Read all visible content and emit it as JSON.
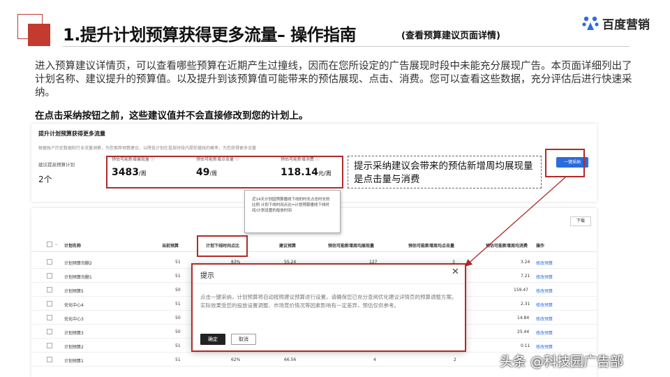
{
  "slide": {
    "title": "1.提升计划预算获得更多流量– 操作指南",
    "subtitle": "(查看预算建议页面详情)",
    "logo_text": "百度营销",
    "intro": "进入预算建议详情页，可以查看哪些预算在近期产生过撞线，因而在您所设定的广告展现时段中未能充分展现广告。本页面详细列出了计划名称、建议提升的预算值。以及提升到该预算值可能带来的预估展现、点击、消费。您可以查看这些数据，充分评估后进行快速采纳。",
    "warning": "在点击采纳按钮之前，这些建议值并不会直接修改到您的计划上。",
    "callout": "提示采纳建议会带来的预估新增周均展现量是点击量与消费",
    "watermark": "头条 @科技园广告部"
  },
  "summary_panel": {
    "title": "提升计划预算获得更多流量",
    "description": "根据账户历史数据和行业流量洞察，为您推荐预算建议，以降低计划在投放时段内提前撞线的概率，为您获得更多流量",
    "count_label": "建议提高预算计划",
    "count_value": "2个",
    "metrics": [
      {
        "label": "预估可能新增展现量 ⓘ",
        "value": "3483",
        "unit": "/周"
      },
      {
        "label": "预估可能新增点击量 ⓘ",
        "value": "49",
        "unit": "/周"
      },
      {
        "label": "预估可能新增消费 ⓘ",
        "value": "118.14",
        "unit": "元/周"
      }
    ],
    "adopt_button": "一键采纳"
  },
  "tooltip": {
    "text": "近14天计划因预算撞线下线的时长占总时长的比例 计划下线时间点比=计划预算撞线下线时间/计划设置的投放时间"
  },
  "table": {
    "download_label": "下载",
    "columns": [
      "计划名称",
      "当前预算",
      "计划下线时间点比",
      "建议预算",
      "预估可能新增周均展现量",
      "预估可能新增周均点击量",
      "预估可能新增周均消费",
      "操作"
    ],
    "rows": [
      {
        "name": "计划预算勿删2",
        "budget": "51",
        "ratio": "83%",
        "suggest": "55.24",
        "impr": "127",
        "clicks": "3",
        "cost": "3.24",
        "action": "修改预算"
      },
      {
        "name": "计划预算勿删1",
        "budget": "51",
        "ratio": "",
        "suggest": "",
        "impr": "",
        "clicks": "",
        "cost": "7.21",
        "action": "修改预算"
      },
      {
        "name": "计划预算5",
        "budget": "50",
        "ratio": "",
        "suggest": "",
        "impr": "",
        "clicks": "",
        "cost": "159.47",
        "action": "修改预算"
      },
      {
        "name": "优化中心4",
        "budget": "51",
        "ratio": "",
        "suggest": "",
        "impr": "",
        "clicks": "",
        "cost": "2.31",
        "action": "修改预算"
      },
      {
        "name": "优化中心3",
        "budget": "50",
        "ratio": "",
        "suggest": "",
        "impr": "",
        "clicks": "",
        "cost": "14.84",
        "action": "修改预算"
      },
      {
        "name": "计划预算3",
        "budget": "50",
        "ratio": "",
        "suggest": "",
        "impr": "",
        "clicks": "",
        "cost": "25.44",
        "action": "修改预算"
      },
      {
        "name": "计划预算2",
        "budget": "51",
        "ratio": "",
        "suggest": "",
        "impr": "",
        "clicks": "",
        "cost": "0.11",
        "action": "修改预算"
      },
      {
        "name": "计划预算1",
        "budget": "51",
        "ratio": "62%",
        "suggest": "66.56",
        "impr": "4",
        "clicks": "2",
        "cost": "",
        "action": ""
      }
    ]
  },
  "modal": {
    "title": "提示",
    "close": "✕",
    "body": "点击一键采纳，计划预算将自动按照建议预算进行设置，请确保您已充分查阅优化建议详情页的预算调整方案。实际效果受您的投放设置调整、市场竞价情况等因素影响有一定差异，预估仅供参考。",
    "ok_label": "确定",
    "cancel_label": "取消"
  },
  "colors": {
    "accent_red": "#b02a2a",
    "deco_red": "#c33a2e",
    "link_blue": "#2c6bdc",
    "modal_ok": "#222222"
  }
}
